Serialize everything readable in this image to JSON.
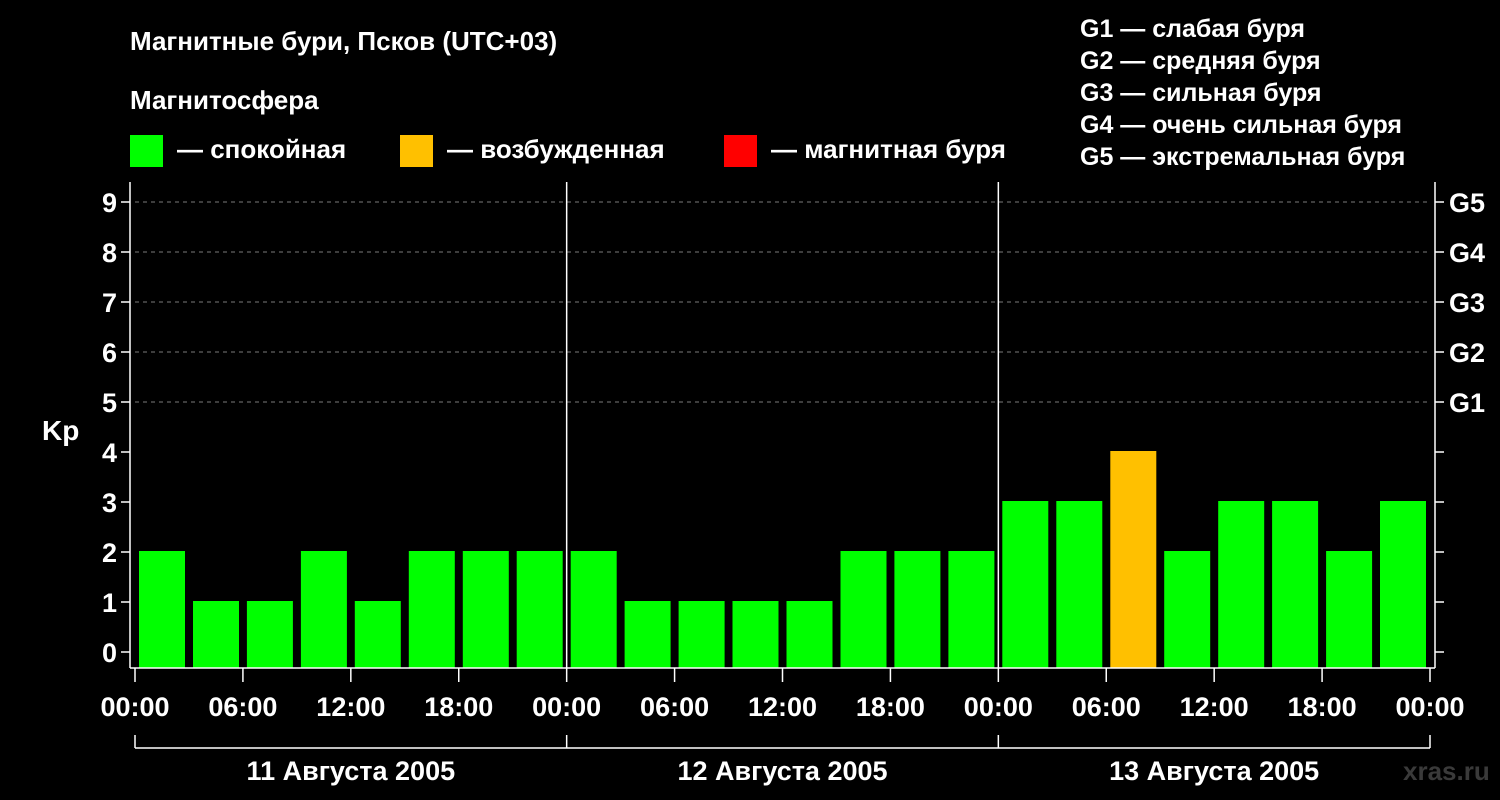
{
  "chart_data": {
    "type": "bar",
    "title": "Магнитные бури, Псков (UTC+03)",
    "ylabel": "Kp",
    "ylim": [
      0,
      9
    ],
    "yticks": [
      0,
      1,
      2,
      3,
      4,
      5,
      6,
      7,
      8,
      9
    ],
    "storm_levels": [
      {
        "kp": 5,
        "label": "G1"
      },
      {
        "kp": 6,
        "label": "G2"
      },
      {
        "kp": 7,
        "label": "G3"
      },
      {
        "kp": 8,
        "label": "G4"
      },
      {
        "kp": 9,
        "label": "G5"
      }
    ],
    "x_tick_labels": [
      "00:00",
      "06:00",
      "12:00",
      "18:00",
      "00:00",
      "06:00",
      "12:00",
      "18:00",
      "00:00",
      "06:00",
      "12:00",
      "18:00",
      "00:00"
    ],
    "days": [
      "11 Августа 2005",
      "12 Августа 2005",
      "13 Августа 2005"
    ],
    "interval_hours": 3,
    "values": [
      2,
      1,
      1,
      2,
      1,
      2,
      2,
      2,
      2,
      1,
      1,
      1,
      1,
      2,
      2,
      2,
      3,
      3,
      4,
      2,
      3,
      3,
      2,
      3
    ],
    "grid": true,
    "legend": {
      "heading": "Магнитосфера",
      "items": [
        {
          "label": "— спокойная",
          "color": "#00ff00"
        },
        {
          "label": "— возбужденная",
          "color": "#ffc000"
        },
        {
          "label": "— магнитная буря",
          "color": "#ff0000"
        }
      ]
    },
    "storm_legend": [
      "G1 — слабая буря",
      "G2 — средняя буря",
      "G3 — сильная буря",
      "G4 — очень сильная буря",
      "G5 — экстремальная буря"
    ],
    "colors": {
      "quiet": "#00ff00",
      "active": "#ffc000",
      "storm": "#ff0000"
    }
  },
  "watermark": "xras.ru"
}
